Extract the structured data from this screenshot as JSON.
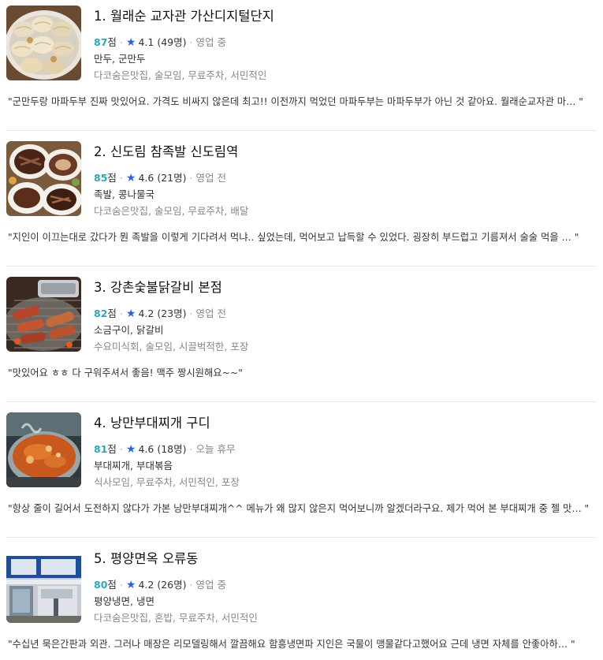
{
  "restaurants": [
    {
      "title": "1. 월래순 교자관 가산디지털단지",
      "score": "87",
      "score_unit": "점",
      "rating": "4.1 (49명)",
      "status": "영업 중",
      "category": "만두, 군만두",
      "tags": "다코숨은맛집, 술모임, 무료주차, 서민적인",
      "review": "\"군만두랑 마파두부 진짜 맛있어요. 가격도 비싸지 않은데 최고!! 이전까지 먹었던 마파두부는 마파두부가 아닌 것 같아요. 월래순교자관 마… \""
    },
    {
      "title": "2. 신도림 참족발 신도림역",
      "score": "85",
      "score_unit": "점",
      "rating": "4.6 (21명)",
      "status": "영업 전",
      "category": "족발, 콩나물국",
      "tags": "다코숨은맛집, 술모임, 무료주차, 배달",
      "review": "\"지인이 이끄는대로 갔다가 뭔 족발을 이렇게 기다려서 먹냐.. 싶었는데, 먹어보고 납득할 수 있었다. 굉장히 부드럽고 기름져서 술술 먹을 … \""
    },
    {
      "title": "3. 강촌숯불닭갈비 본점",
      "score": "82",
      "score_unit": "점",
      "rating": "4.2 (23명)",
      "status": "영업 전",
      "category": "소금구이, 닭갈비",
      "tags": "수요미식회, 술모임, 시끌벅적한, 포장",
      "review": "\"맛있어요 ㅎㅎ 다 구워주셔서 좋음! 맥주 짱시원해요~~\""
    },
    {
      "title": "4. 낭만부대찌개 구디",
      "score": "81",
      "score_unit": "점",
      "rating": "4.6 (18명)",
      "status": "오늘 휴무",
      "category": "부대찌개, 부대볶음",
      "tags": "식사모임, 무료주차, 서민적인, 포장",
      "review": "\"항상 줄이 길어서 도전하지 않다가 가본 낭만부대찌개^^ 메뉴가 왜 많지 않은지 먹어보니까 알겠더라구요. 제가 먹어 본 부대찌개 중 젤 맛… \""
    },
    {
      "title": "5. 평양면옥 오류동",
      "score": "80",
      "score_unit": "점",
      "rating": "4.2 (26명)",
      "status": "영업 중",
      "category": "평양냉면, 냉면",
      "tags": "다코숨은맛집, 혼밥, 무료주차, 서민적인",
      "review": "\"수십년 묵은간판과 외관. 그러나 매장은 리모델링해서 깔끔해요 함흥냉면파 지인은 국물이 맹물같다고했어요 근데 냉면 자체를 안좋아하… \""
    }
  ],
  "icons": {
    "rating": "star-icon"
  },
  "colors": {
    "score": "#2fa7b8",
    "star": "#2b65d9",
    "muted": "#888888"
  }
}
